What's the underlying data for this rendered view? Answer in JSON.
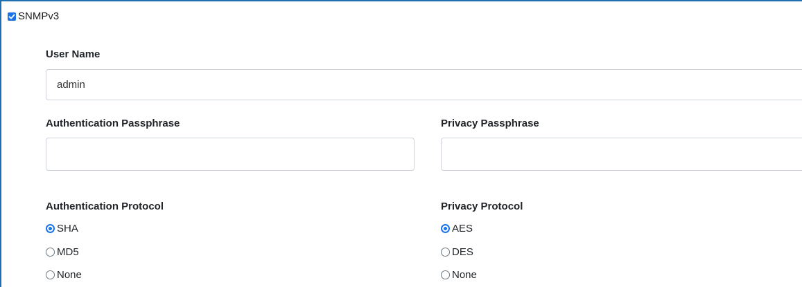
{
  "section": {
    "legend": "SNMPv3",
    "enabled": true
  },
  "user_name": {
    "label": "User Name",
    "value": "admin"
  },
  "auth_passphrase": {
    "label": "Authentication Passphrase",
    "value": ""
  },
  "privacy_passphrase": {
    "label": "Privacy Passphrase",
    "value": ""
  },
  "auth_protocol": {
    "label": "Authentication Protocol",
    "selected": "SHA",
    "options": [
      "SHA",
      "MD5",
      "None"
    ]
  },
  "privacy_protocol": {
    "label": "Privacy Protocol",
    "selected": "AES",
    "options": [
      "AES",
      "DES",
      "None"
    ]
  },
  "colors": {
    "accent": "#1a73e8",
    "panel_border": "#1f6fb2",
    "input_border": "#ced4da"
  }
}
